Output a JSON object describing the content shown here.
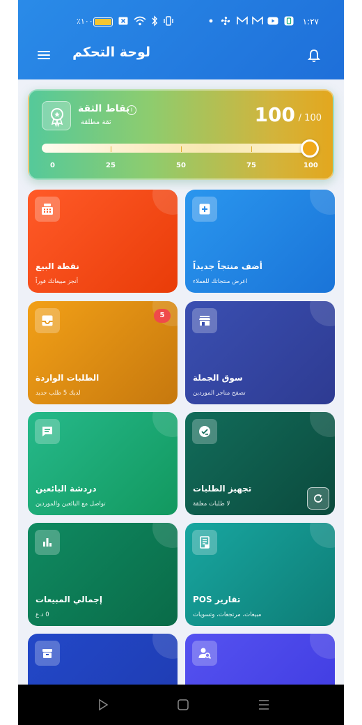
{
  "status_bar": {
    "time": "١:٢٧",
    "battery_percent": "١٠٠٪",
    "icons": [
      "dot-icon",
      "fan-icon",
      "gmail-icon",
      "gmail-icon",
      "youtube-icon",
      "app-icon",
      "vibrate-icon",
      "bluetooth-icon",
      "wifi-icon",
      "sim-x-icon",
      "battery-icon"
    ],
    "battery_color": "#f4c531"
  },
  "header": {
    "title": "لوحة التحكم",
    "menu_icon": "menu-icon",
    "bell_icon": "bell-icon",
    "color": "#1e6fd9"
  },
  "trust": {
    "title": "نقاط الثقة",
    "subtitle": "ثقة مطلقة",
    "score": "100",
    "max": "/ 100",
    "level": 1.0,
    "scale": [
      "0",
      "25",
      "50",
      "75",
      "100"
    ],
    "badge_icon": "award-icon",
    "info_icon": "info-icon"
  },
  "tiles": [
    {
      "id": "pos",
      "title": "نقطة البيع",
      "subtitle": "أنجز مبيعاتك فوراً",
      "icon": "cash-register-icon",
      "color": "#ff5a28"
    },
    {
      "id": "add-product",
      "title": "أضف منتجاً جديداً",
      "subtitle": "اعرض منتجاتك للعملاء",
      "icon": "plus-square-icon",
      "color": "#2a96ee"
    },
    {
      "id": "incoming-orders",
      "title": "الطلبات الواردة",
      "subtitle": "لديك 5 طلب جديد",
      "icon": "inbox-icon",
      "badge": "5",
      "color": "#f2a017"
    },
    {
      "id": "wholesale-market",
      "title": "سوق الجملة",
      "subtitle": "تصفح متاجر الموردين",
      "icon": "store-icon",
      "color": "#3a4fb1"
    },
    {
      "id": "sellers-chat",
      "title": "دردشة البائعين",
      "subtitle": "تواصل مع البائعين والموردين",
      "icon": "chat-icon",
      "color": "#26b98a"
    },
    {
      "id": "order-prep",
      "title": "تجهيز الطلبات",
      "subtitle": "لا طلبات معلقة",
      "icon": "checklist-icon",
      "color": "#126c5a"
    },
    {
      "id": "sales-total",
      "title": "إجمالي المبيعات",
      "subtitle": "0 د.ع",
      "icon": "bar-chart-icon",
      "color": "#0f8a61"
    },
    {
      "id": "pos-reports",
      "title": "تقارير POS",
      "subtitle": "مبيعات، مرتجعات، وتسويات",
      "icon": "receipt-icon",
      "color": "#18a6a0"
    },
    {
      "id": "archive",
      "title": "",
      "subtitle": "",
      "icon": "archive-icon",
      "color": "#2248c8"
    },
    {
      "id": "user-search",
      "title": "",
      "subtitle": "",
      "icon": "user-search-icon",
      "color": "#5552f0"
    }
  ],
  "navbar": {
    "icons": [
      "back-triangle-icon",
      "home-square-icon",
      "recents-lines-icon"
    ]
  }
}
